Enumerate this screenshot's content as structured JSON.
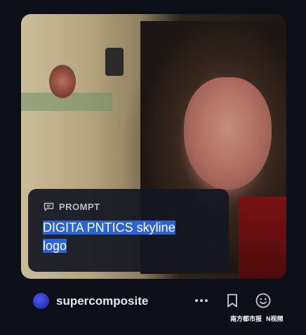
{
  "card": {
    "prompt_label": "PROMPT",
    "prompt_text_line1": "DIGITA PNTICS skyline",
    "prompt_text_line2": "logo"
  },
  "author": {
    "name": "supercomposite",
    "avatar_color": "#2f39c9"
  },
  "actions": {
    "more_icon": "more-dots-icon",
    "bookmark_icon": "bookmark-icon",
    "reaction_icon": "smiley-icon"
  },
  "watermark": {
    "text1": "南方都市报",
    "text2": "N视频"
  },
  "colors": {
    "background": "#0c0f17",
    "highlight": "#2c63d6"
  }
}
